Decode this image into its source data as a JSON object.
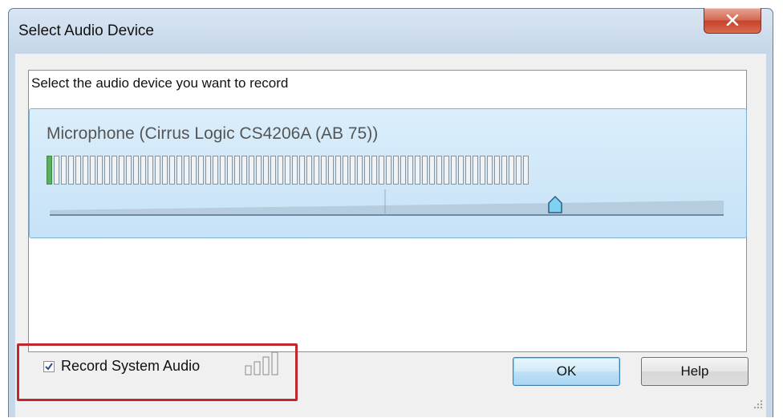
{
  "window": {
    "title": "Select Audio Device"
  },
  "panel": {
    "prompt": "Select the audio device you want to record",
    "device": {
      "name": "Microphone (Cirrus Logic CS4206A (AB 75))",
      "meter_segments": 67,
      "meter_level": 1,
      "volume_fraction": 0.75
    }
  },
  "footer": {
    "record_system_audio": {
      "label": "Record System Audio",
      "checked": true
    },
    "ok_label": "OK",
    "help_label": "Help"
  },
  "colors": {
    "accent_highlight": "#c0282d",
    "meter_active": "#5caf62",
    "selection_fill": "#c6e2f7"
  }
}
